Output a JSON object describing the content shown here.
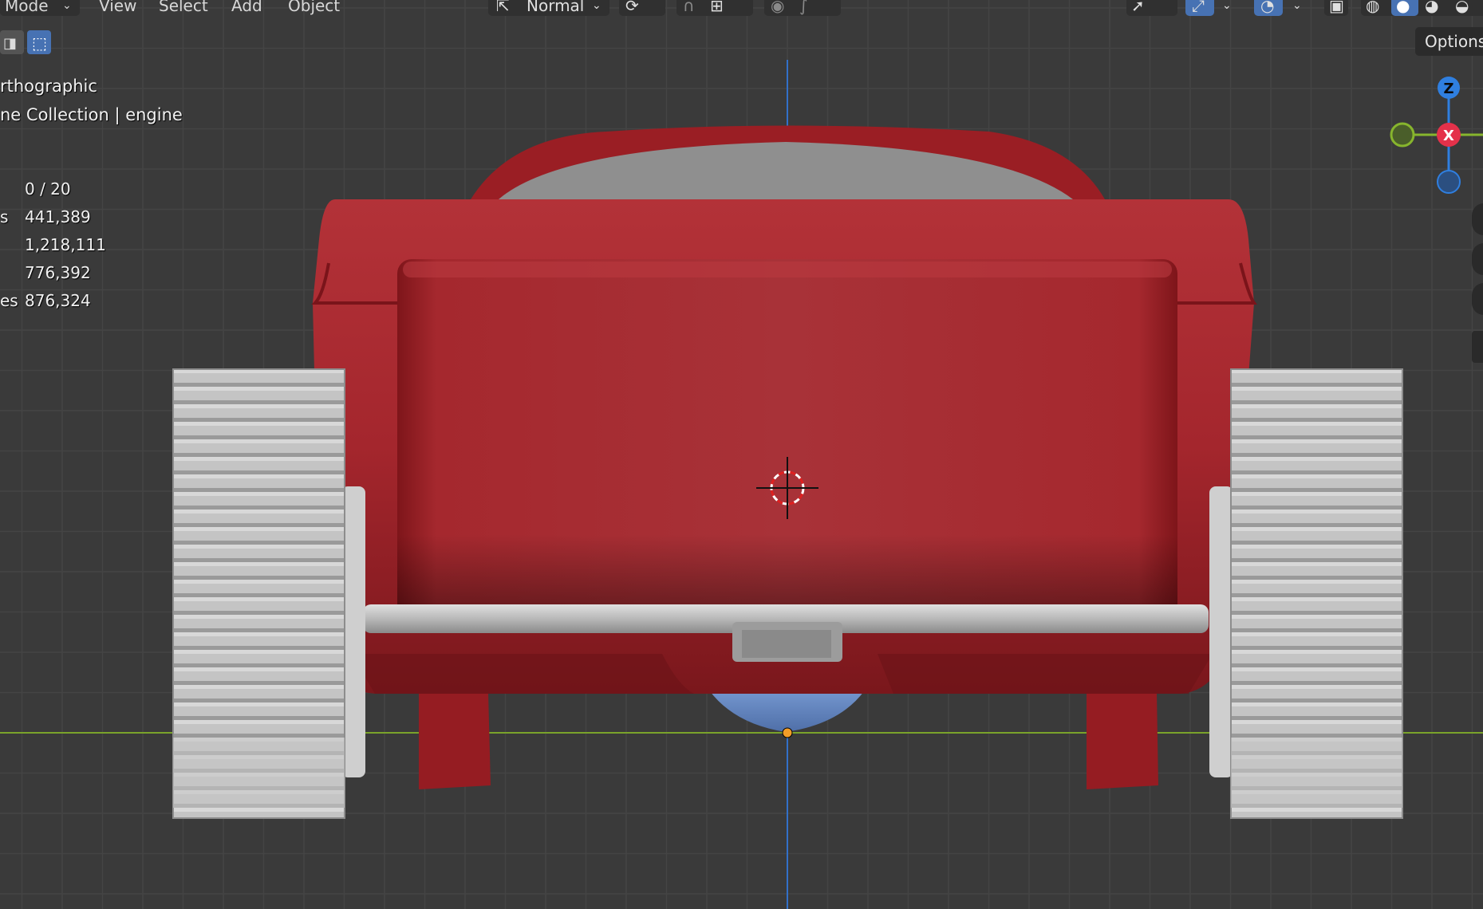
{
  "header": {
    "menus": [
      "Mode",
      "View",
      "Select",
      "Add",
      "Object"
    ],
    "transform_orientation": "Normal",
    "options_label": "Options"
  },
  "overlay": {
    "view_name": "rthographic",
    "collection_line": "ne Collection | engine"
  },
  "stats": [
    {
      "label": "",
      "value": "0 / 20"
    },
    {
      "label": "s",
      "value": "441,389"
    },
    {
      "label": "",
      "value": "1,218,111"
    },
    {
      "label": "",
      "value": "776,392"
    },
    {
      "label": "es",
      "value": "876,324"
    }
  ],
  "gizmo": {
    "z_label": "Z",
    "x_label": "X",
    "colors": {
      "x": "#e4314a",
      "y": "#87b52d",
      "z": "#2f7fe0"
    }
  },
  "colors": {
    "body_red": "#a6252b",
    "wheel_gray": "#bdbdbd",
    "engine_blue": "#6b8fcf",
    "grid_bg": "#3a3a3a",
    "accent": "#4772b3"
  }
}
